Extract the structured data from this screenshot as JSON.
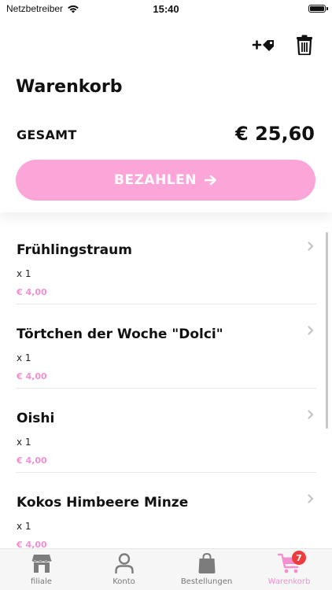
{
  "status_bar": {
    "carrier": "Netzbetreiber",
    "time": "15:40"
  },
  "header": {
    "title": "Warenkorb",
    "total_label": "GESAMT",
    "total_value": "€ 25,60",
    "pay_button_label": "BEZAHLEN",
    "icons": [
      "add-voucher-icon",
      "trash-icon"
    ]
  },
  "cart": {
    "items": [
      {
        "name": "Frühlingstraum",
        "qty": "x 1",
        "price": "€ 4,00"
      },
      {
        "name": "Törtchen der Woche \"Dolci\"",
        "qty": "x 1",
        "price": "€ 4,00"
      },
      {
        "name": "Oishi",
        "qty": "x 1",
        "price": "€ 4,00"
      },
      {
        "name": "Kokos Himbeere Minze",
        "qty": "x 1",
        "price": "€ 4,00"
      }
    ]
  },
  "tabbar": {
    "tabs": [
      {
        "label": "filiale",
        "icon": "shop-icon"
      },
      {
        "label": "Konto",
        "icon": "user-icon"
      },
      {
        "label": "Bestellungen",
        "icon": "bag-icon"
      },
      {
        "label": "Warenkorb",
        "icon": "cart-icon",
        "badge": "7",
        "active": true
      }
    ]
  },
  "colors": {
    "accent": "#f48fd0",
    "button": "#fba5d9",
    "badge": "#ef3b3b"
  }
}
